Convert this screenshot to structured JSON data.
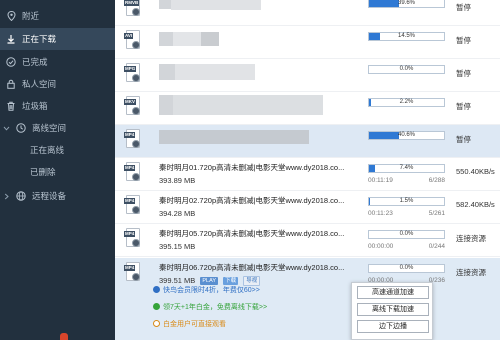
{
  "sidebar": {
    "items": [
      {
        "label": "附近",
        "icon": "location-pin-icon",
        "active": false
      },
      {
        "label": "正在下载",
        "icon": "download-arrow-icon",
        "active": true
      },
      {
        "label": "已完成",
        "icon": "check-circle-icon",
        "active": false
      },
      {
        "label": "私人空间",
        "icon": "lock-icon",
        "active": false
      },
      {
        "label": "垃圾箱",
        "icon": "trash-icon",
        "active": false
      },
      {
        "label": "离线空间",
        "icon": "chevron-down-icon",
        "active": false
      }
    ],
    "subitems": [
      {
        "label": "正在离线"
      },
      {
        "label": "已删除"
      }
    ],
    "remote": {
      "label": "远程设备",
      "icon": "globe-icon"
    }
  },
  "downloads": [
    {
      "tag": "RMVB",
      "name": "",
      "size": "",
      "progress": 39.6,
      "pct_text": "39.6%",
      "elapsed": "",
      "pieces": "",
      "status": "暂停"
    },
    {
      "tag": "AVI",
      "name": "",
      "size": "",
      "progress": 14.5,
      "pct_text": "14.5%",
      "elapsed": "",
      "pieces": "",
      "status": "暂停"
    },
    {
      "tag": "MPG",
      "name": "",
      "size": "",
      "progress": 0,
      "pct_text": "0.0%",
      "elapsed": "",
      "pieces": "",
      "status": "暂停"
    },
    {
      "tag": "MKV",
      "name": "",
      "size": "",
      "progress": 2.2,
      "pct_text": "2.2%",
      "elapsed": "",
      "pieces": "",
      "status": "暂停"
    },
    {
      "tag": "MP4",
      "name": "",
      "size": "",
      "progress": 40.6,
      "pct_text": "40.6%",
      "elapsed": "",
      "pieces": "",
      "status": "暂停"
    },
    {
      "tag": "MP4",
      "name": "秦时明月01.720p高清未删减|电影天堂www.dy2018.co...",
      "size": "393.89 MB",
      "progress": 7.4,
      "pct_text": "7.4%",
      "elapsed": "00:11:19",
      "pieces": "6/288",
      "status": "550.40KB/s"
    },
    {
      "tag": "MP4",
      "name": "秦时明月02.720p高清未删减|电影天堂www.dy2018.co...",
      "size": "394.28 MB",
      "progress": 1.5,
      "pct_text": "1.5%",
      "elapsed": "00:11:23",
      "pieces": "5/261",
      "status": "582.40KB/s"
    },
    {
      "tag": "MP4",
      "name": "秦时明月05.720p高清未删减|电影天堂www.dy2018.co...",
      "size": "395.15 MB",
      "progress": 0,
      "pct_text": "0.0%",
      "elapsed": "00:00:00",
      "pieces": "0/244",
      "status": "连接资源"
    },
    {
      "tag": "MP4",
      "name": "秦时明月06.720p高清未删减|电影天堂www.dy2018.co...",
      "size": "399.51 MB",
      "progress": 0,
      "pct_text": "0.0%",
      "elapsed": "00:00:00",
      "pieces": "0/236",
      "status": "连接资源",
      "chips": {
        "play": "PLAY",
        "download": "下载",
        "hd": "导视"
      }
    }
  ],
  "promos": [
    {
      "text": "快鸟会员限时4折，年费仅60>>",
      "color": "#2f6fc4"
    },
    {
      "text": "领7天+1年白金，免费离线下载>>",
      "color": "#35a33a"
    },
    {
      "text": "白金用户可直接观看",
      "color": "#d98a16"
    }
  ],
  "popup": {
    "buttons": [
      "高速通道加速",
      "离线下载加速",
      "边下边播"
    ]
  },
  "colors": {
    "sidebar_bg": "#22303e",
    "sidebar_active": "#35485b",
    "progress_fill": "#2f79d4",
    "row_highlight": "#dde8f4"
  }
}
